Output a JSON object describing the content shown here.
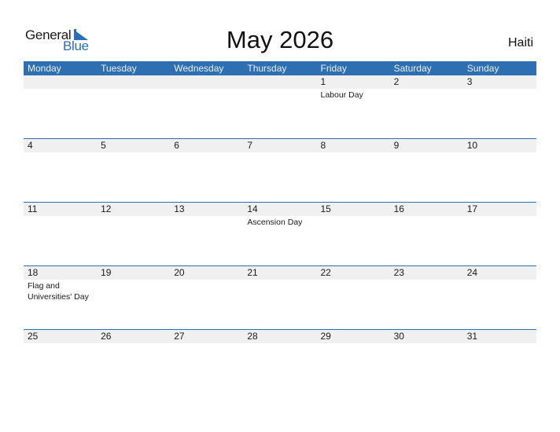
{
  "brand": {
    "line1": "General",
    "line2": "Blue",
    "color": "#2a6eb5"
  },
  "title": "May 2026",
  "country": "Haiti",
  "weekdays": [
    "Monday",
    "Tuesday",
    "Wednesday",
    "Thursday",
    "Friday",
    "Saturday",
    "Sunday"
  ],
  "weeks": [
    {
      "days": [
        {
          "num": "",
          "holiday": ""
        },
        {
          "num": "",
          "holiday": ""
        },
        {
          "num": "",
          "holiday": ""
        },
        {
          "num": "",
          "holiday": ""
        },
        {
          "num": "1",
          "holiday": "Labour Day"
        },
        {
          "num": "2",
          "holiday": ""
        },
        {
          "num": "3",
          "holiday": ""
        }
      ]
    },
    {
      "days": [
        {
          "num": "4",
          "holiday": ""
        },
        {
          "num": "5",
          "holiday": ""
        },
        {
          "num": "6",
          "holiday": ""
        },
        {
          "num": "7",
          "holiday": ""
        },
        {
          "num": "8",
          "holiday": ""
        },
        {
          "num": "9",
          "holiday": ""
        },
        {
          "num": "10",
          "holiday": ""
        }
      ]
    },
    {
      "days": [
        {
          "num": "11",
          "holiday": ""
        },
        {
          "num": "12",
          "holiday": ""
        },
        {
          "num": "13",
          "holiday": ""
        },
        {
          "num": "14",
          "holiday": "Ascension Day"
        },
        {
          "num": "15",
          "holiday": ""
        },
        {
          "num": "16",
          "holiday": ""
        },
        {
          "num": "17",
          "holiday": ""
        }
      ]
    },
    {
      "days": [
        {
          "num": "18",
          "holiday": "Flag and Universities' Day"
        },
        {
          "num": "19",
          "holiday": ""
        },
        {
          "num": "20",
          "holiday": ""
        },
        {
          "num": "21",
          "holiday": ""
        },
        {
          "num": "22",
          "holiday": ""
        },
        {
          "num": "23",
          "holiday": ""
        },
        {
          "num": "24",
          "holiday": ""
        }
      ]
    },
    {
      "days": [
        {
          "num": "25",
          "holiday": ""
        },
        {
          "num": "26",
          "holiday": ""
        },
        {
          "num": "27",
          "holiday": ""
        },
        {
          "num": "28",
          "holiday": ""
        },
        {
          "num": "29",
          "holiday": ""
        },
        {
          "num": "30",
          "holiday": ""
        },
        {
          "num": "31",
          "holiday": ""
        }
      ]
    }
  ],
  "colors": {
    "header_bg": "#2e6fb1",
    "date_strip": "#f0f0f0"
  }
}
